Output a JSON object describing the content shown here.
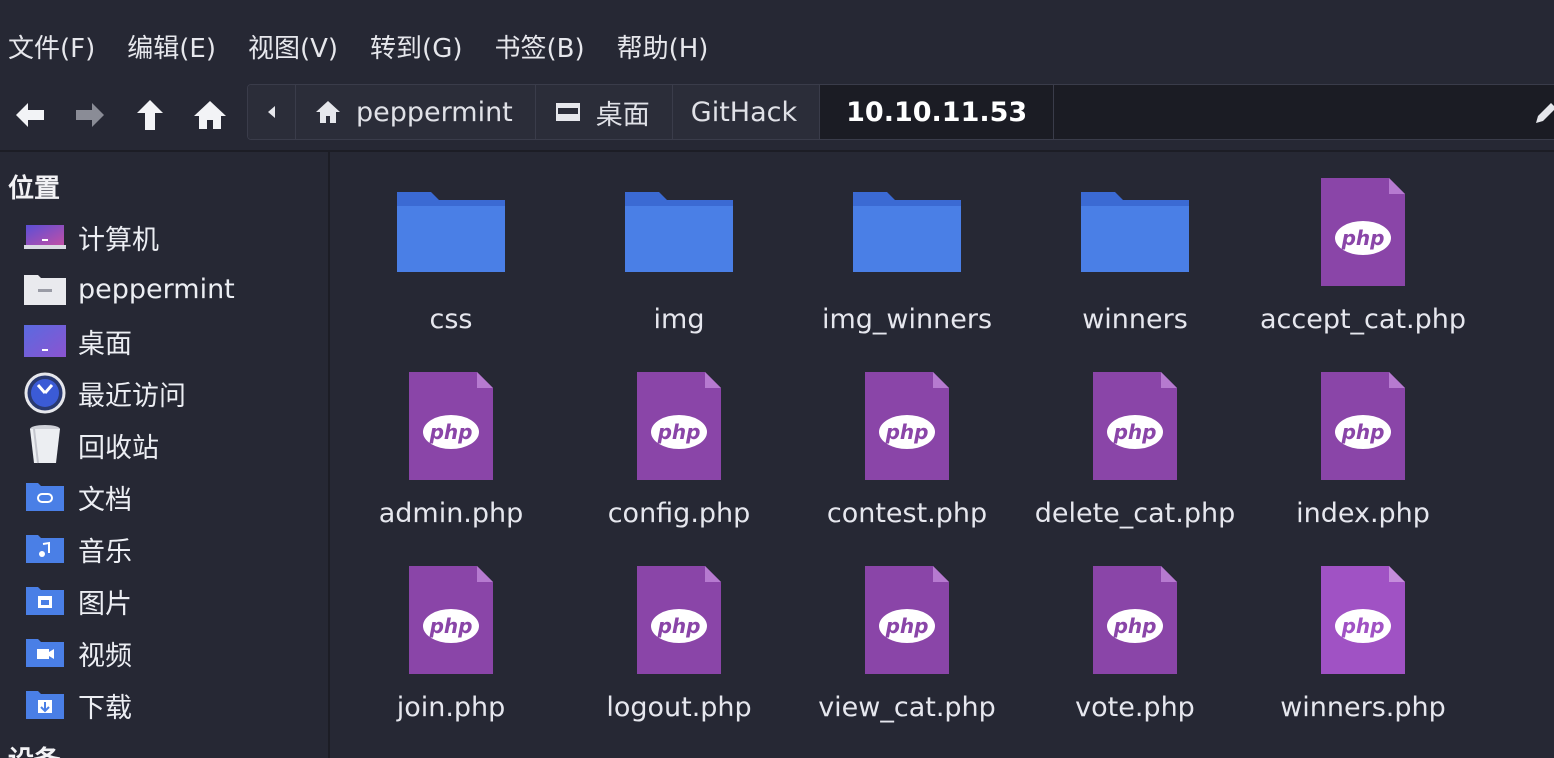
{
  "menu": [
    "文件(F)",
    "编辑(E)",
    "视图(V)",
    "转到(G)",
    "书签(B)",
    "帮助(H)"
  ],
  "toolbar": {
    "icons": [
      "back-arrow-icon",
      "forward-arrow-icon",
      "up-arrow-icon",
      "home-icon"
    ]
  },
  "breadcrumb": {
    "items": [
      {
        "label": "peppermint",
        "icon": "home-icon"
      },
      {
        "label": "桌面",
        "icon": "desktop-icon"
      },
      {
        "label": "GitHack",
        "icon": ""
      },
      {
        "label": "10.10.11.53",
        "icon": "",
        "active": true
      }
    ]
  },
  "sidebar": {
    "places_heading": "位置",
    "items": [
      {
        "label": "计算机",
        "icon": "computer-icon"
      },
      {
        "label": "peppermint",
        "icon": "home-folder-icon"
      },
      {
        "label": "桌面",
        "icon": "desktop-icon"
      },
      {
        "label": "最近访问",
        "icon": "recent-clock-icon"
      },
      {
        "label": "回收站",
        "icon": "trash-icon"
      },
      {
        "label": "文档",
        "icon": "documents-folder-icon"
      },
      {
        "label": "音乐",
        "icon": "music-folder-icon"
      },
      {
        "label": "图片",
        "icon": "pictures-folder-icon"
      },
      {
        "label": "视频",
        "icon": "videos-folder-icon"
      },
      {
        "label": "下载",
        "icon": "downloads-folder-icon"
      }
    ],
    "devices_heading": "设备"
  },
  "files": [
    {
      "name": "css",
      "type": "folder"
    },
    {
      "name": "img",
      "type": "folder"
    },
    {
      "name": "img_winners",
      "type": "folder"
    },
    {
      "name": "winners",
      "type": "folder"
    },
    {
      "name": "accept_cat.php",
      "type": "php"
    },
    {
      "name": "admin.php",
      "type": "php"
    },
    {
      "name": "config.php",
      "type": "php"
    },
    {
      "name": "contest.php",
      "type": "php"
    },
    {
      "name": "delete_cat.php",
      "type": "php"
    },
    {
      "name": "index.php",
      "type": "php"
    },
    {
      "name": "join.php",
      "type": "php"
    },
    {
      "name": "logout.php",
      "type": "php"
    },
    {
      "name": "view_cat.php",
      "type": "php"
    },
    {
      "name": "vote.php",
      "type": "php"
    },
    {
      "name": "winners.php",
      "type": "php"
    }
  ],
  "colors": {
    "background": "#262834",
    "folder": "#4a7fe6",
    "php": "#8a45a8",
    "php_selected": "#a052c4"
  }
}
